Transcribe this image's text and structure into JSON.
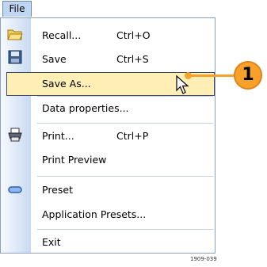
{
  "menubar": {
    "file_label": "File"
  },
  "menu": {
    "items": [
      {
        "label": "Recall...",
        "shortcut": "Ctrl+O"
      },
      {
        "label": "Save",
        "shortcut": "Ctrl+S"
      },
      {
        "label": "Save As..."
      },
      {
        "label": "Data properties..."
      },
      {
        "label": "Print...",
        "shortcut": "Ctrl+P"
      },
      {
        "label": "Print Preview"
      },
      {
        "label": "Preset"
      },
      {
        "label": "Application Presets..."
      },
      {
        "label": "Exit"
      }
    ]
  },
  "callout": {
    "number": "1"
  },
  "figure_id": "1909-039",
  "colors": {
    "accent": "#f7a12a",
    "highlight": "#ffefb5",
    "gutter": "#c9daf2"
  },
  "icons": [
    "folder-open-icon",
    "floppy-disk-icon",
    "printer-icon",
    "preset-icon",
    "mouse-pointer-icon"
  ]
}
